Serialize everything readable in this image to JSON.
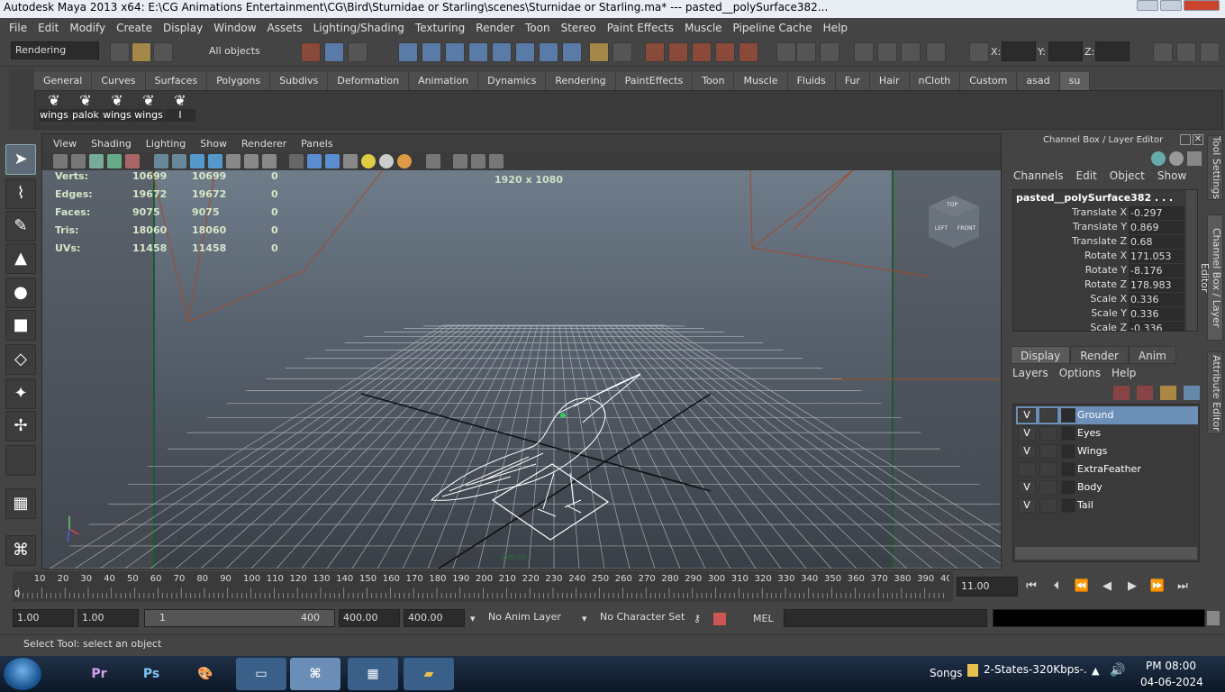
{
  "window": {
    "title": "Autodesk Maya 2013 x64: E:\\CG Animations Entertainment\\CG\\Bird\\Sturnidae or Starling\\scenes\\Sturnidae or Starling.ma*   ---   pasted__polySurface382..."
  },
  "menubar": [
    "File",
    "Edit",
    "Modify",
    "Create",
    "Display",
    "Window",
    "Assets",
    "Lighting/Shading",
    "Texturing",
    "Render",
    "Toon",
    "Stereo",
    "Paint Effects",
    "Muscle",
    "Pipeline Cache",
    "Help"
  ],
  "statusline": {
    "menuset": "Rendering",
    "selection_mask": "All objects",
    "x_label": "X:",
    "y_label": "Y:",
    "z_label": "Z:"
  },
  "shelf_tabs": [
    "General",
    "Curves",
    "Surfaces",
    "Polygons",
    "Subdivs",
    "Deformation",
    "Animation",
    "Dynamics",
    "Rendering",
    "PaintEffects",
    "Toon",
    "Muscle",
    "Fluids",
    "Fur",
    "Hair",
    "nCloth",
    "Custom",
    "asad",
    "su"
  ],
  "shelf_active": "su",
  "shelf_buttons": [
    "wings",
    "palok",
    "wings",
    "wings",
    "I"
  ],
  "panel_menu": [
    "View",
    "Shading",
    "Lighting",
    "Show",
    "Renderer",
    "Panels"
  ],
  "hud": {
    "rows": [
      {
        "label": "Verts:",
        "a": "10699",
        "b": "10699",
        "c": "0"
      },
      {
        "label": "Edges:",
        "a": "19672",
        "b": "19672",
        "c": "0"
      },
      {
        "label": "Faces:",
        "a": "9075",
        "b": "9075",
        "c": "0"
      },
      {
        "label": "Tris:",
        "a": "18060",
        "b": "18060",
        "c": "0"
      },
      {
        "label": "UVs:",
        "a": "11458",
        "b": "11458",
        "c": "0"
      }
    ],
    "resolution": "1920 x 1080",
    "camera": "persp"
  },
  "viewcube": {
    "top": "TOP",
    "left": "LEFT",
    "front": "FRONT"
  },
  "channel_box": {
    "title": "Channel Box / Layer Editor",
    "menu": [
      "Channels",
      "Edit",
      "Object",
      "Show"
    ],
    "object": "pasted__polySurface382 . . .",
    "channels": [
      {
        "label": "Translate X",
        "value": "-0.297"
      },
      {
        "label": "Translate Y",
        "value": "0.869"
      },
      {
        "label": "Translate Z",
        "value": "0.68"
      },
      {
        "label": "Rotate X",
        "value": "171.053"
      },
      {
        "label": "Rotate Y",
        "value": "-8.176"
      },
      {
        "label": "Rotate Z",
        "value": "178.983"
      },
      {
        "label": "Scale X",
        "value": "0.336"
      },
      {
        "label": "Scale Y",
        "value": "0.336"
      },
      {
        "label": "Scale Z",
        "value": "-0.336"
      }
    ]
  },
  "layer_editor": {
    "tabs": [
      "Display",
      "Render",
      "Anim"
    ],
    "active_tab": "Display",
    "menu": [
      "Layers",
      "Options",
      "Help"
    ],
    "layers": [
      {
        "v": "V",
        "name": "Ground",
        "selected": true
      },
      {
        "v": "V",
        "name": "Eyes",
        "selected": false
      },
      {
        "v": "V",
        "name": "Wings",
        "selected": false
      },
      {
        "v": "",
        "name": "ExtraFeather",
        "selected": false
      },
      {
        "v": "V",
        "name": "Body",
        "selected": false
      },
      {
        "v": "V",
        "name": "Tail",
        "selected": false
      }
    ]
  },
  "side_tabs": [
    "Tool Settings",
    "Channel Box / Layer Editor",
    "Attribute Editor"
  ],
  "timeslider": {
    "ticks": [
      "10",
      "20",
      "30",
      "40",
      "50",
      "60",
      "70",
      "80",
      "90",
      "100",
      "110",
      "120",
      "130",
      "140",
      "150",
      "160",
      "170",
      "180",
      "190",
      "200",
      "210",
      "220",
      "230",
      "240",
      "250",
      "260",
      "270",
      "280",
      "290",
      "300",
      "310",
      "320",
      "330",
      "340",
      "350",
      "360",
      "370",
      "380",
      "390",
      "40"
    ],
    "current_marker": "0",
    "current_frame": "11.00"
  },
  "range": {
    "start": "1.00",
    "anim_start": "1.00",
    "slider_start": "1",
    "slider_end": "400",
    "anim_end": "400.00",
    "end": "400.00",
    "anim_layer": "No Anim Layer",
    "char_set": "No Character Set",
    "mel": "MEL"
  },
  "help_line": "Select Tool: select an object",
  "taskbar": {
    "apps": [
      "Pr",
      "Ps"
    ],
    "tray_label": "Songs",
    "tray_file": "2-States-320Kbps-.",
    "time": "PM 08:00",
    "date": "04-06-2024"
  }
}
